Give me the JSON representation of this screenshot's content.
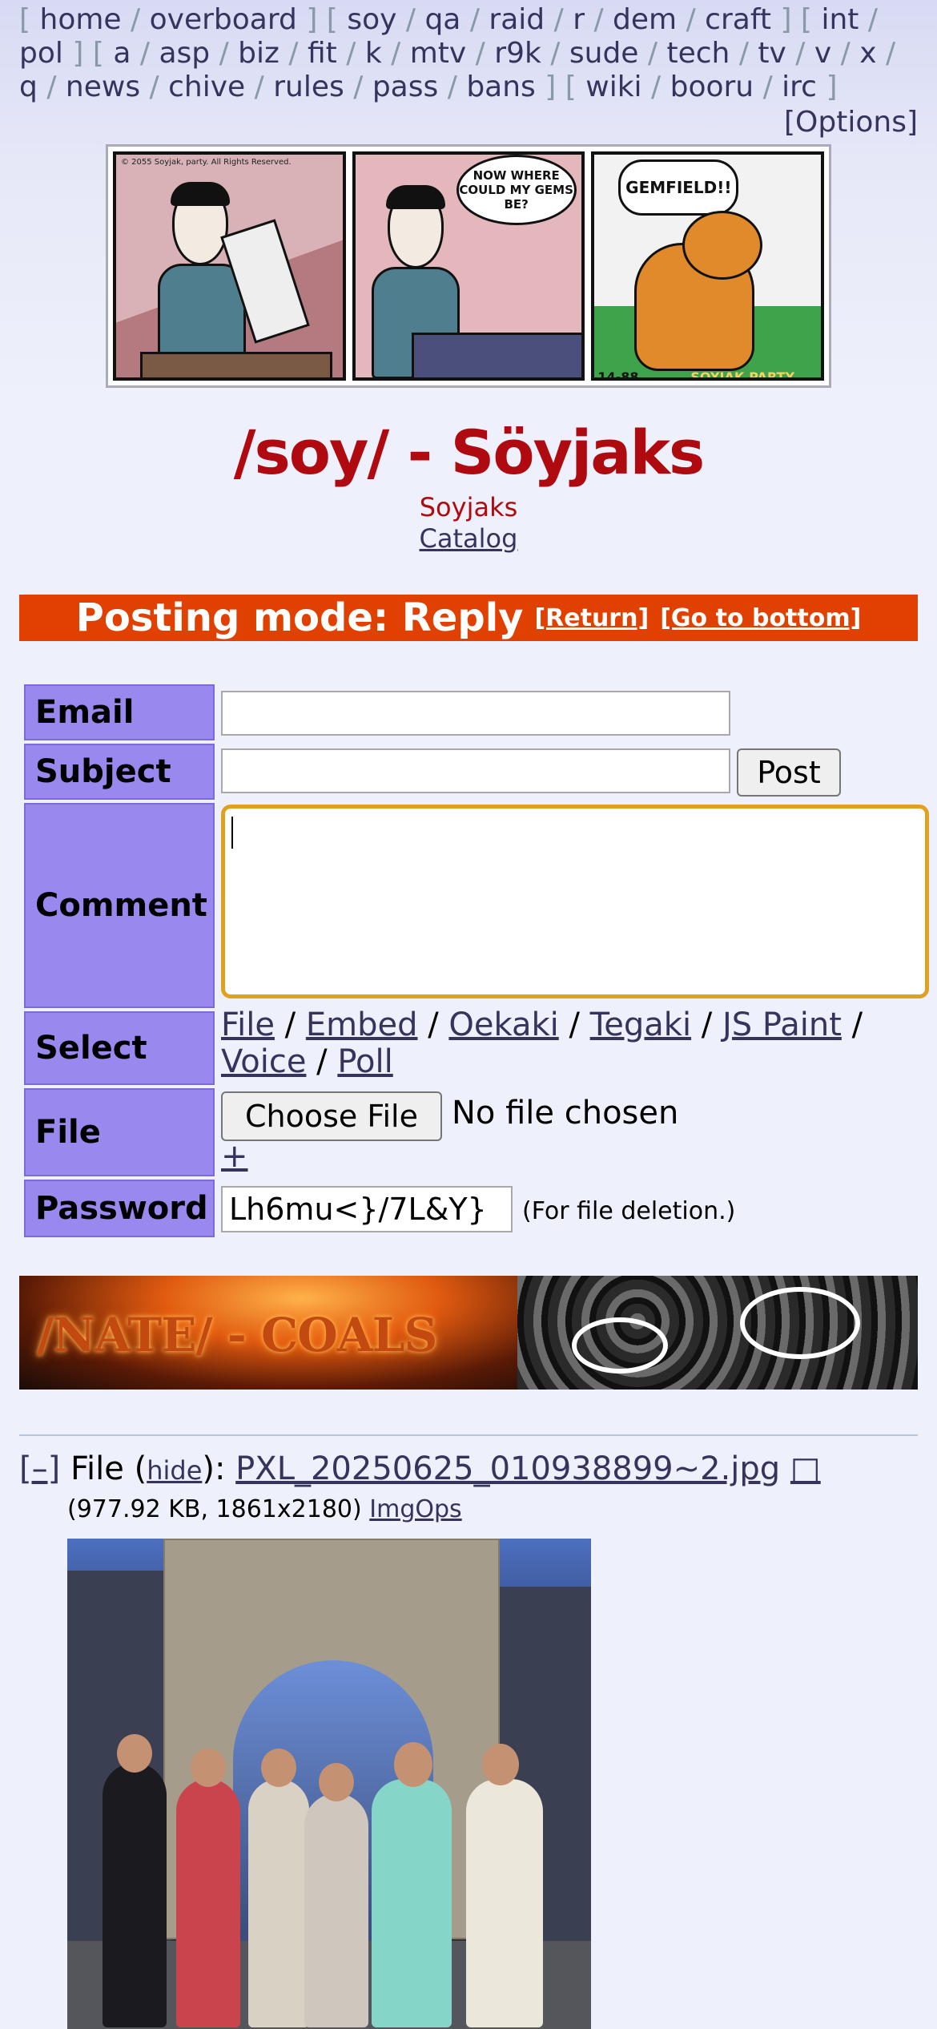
{
  "nav": {
    "groups": [
      [
        "home",
        "overboard"
      ],
      [
        "soy",
        "qa",
        "raid",
        "r",
        "dem",
        "craft"
      ],
      [
        "int",
        "pol"
      ],
      [
        "a",
        "asp",
        "biz",
        "fit",
        "k",
        "mtv",
        "r9k",
        "sude",
        "tech",
        "tv",
        "v",
        "x",
        "q",
        "news",
        "chive",
        "rules",
        "pass",
        "bans"
      ],
      [
        "wiki",
        "booru",
        "irc"
      ]
    ],
    "options": "[Options]"
  },
  "banner": {
    "copyright": "© 2055 Soyjak, party. All Rights Reserved.",
    "bubble1": "NOW WHERE COULD MY GEMS BE?",
    "bubble2": "GEMFIELD!!",
    "date_stamp": "14-88",
    "site_stamp": "SOYJAK.PARTY"
  },
  "board": {
    "title": "/soy/ - Söyjaks",
    "subtitle": "Soyjaks",
    "catalog": "Catalog"
  },
  "posting_mode": {
    "label": "Posting mode: Reply",
    "return_link": "[Return]",
    "bottom_link": "[Go to bottom]"
  },
  "form": {
    "email_label": "Email",
    "subject_label": "Subject",
    "comment_label": "Comment",
    "select_label": "Select",
    "file_label": "File",
    "password_label": "Password",
    "post_button": "Post",
    "select_links": [
      "File",
      "Embed",
      "Oekaki",
      "Tegaki",
      "JS Paint",
      "Voice",
      "Poll"
    ],
    "choose_file": "Choose File",
    "no_file": "No file chosen",
    "plus": "+",
    "password_value": "Lh6mu<}/7L&Y}",
    "password_note": "(For file deletion.)"
  },
  "ad": {
    "text": "/NATE/ - COALS"
  },
  "post": {
    "collapse": "[–]",
    "file_prefix": "File (",
    "hide": "hide",
    "file_suffix": "): ",
    "filename": "PXL_20250625_010938899~2.jpg",
    "file_icon": "□",
    "file_meta": "(977.92 KB, 1861x2180)",
    "imgops": "ImgOps"
  },
  "colors": {
    "title": "#af0a0f",
    "posting_bar": "#e04000",
    "label_cell": "#9988ee",
    "link": "#34345c",
    "focus_ring": "#e0a020"
  }
}
